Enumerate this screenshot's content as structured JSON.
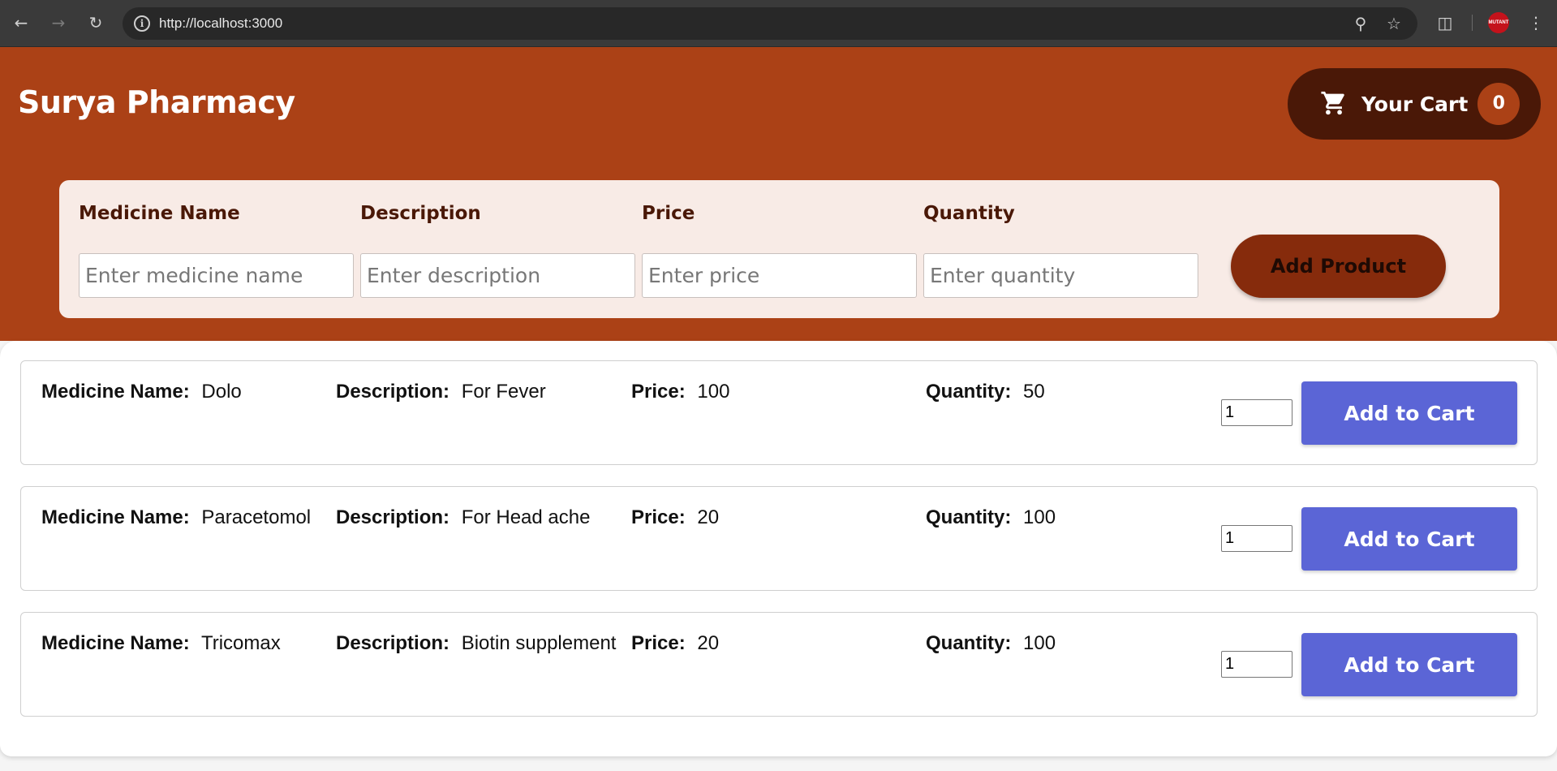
{
  "browser": {
    "url": "http://localhost:3000",
    "profile_badge": "MUTANT"
  },
  "header": {
    "brand": "Surya Pharmacy",
    "cart_label": "Your Cart",
    "cart_count": "0"
  },
  "form": {
    "fields": [
      {
        "label": "Medicine Name",
        "placeholder": "Enter medicine name"
      },
      {
        "label": "Description",
        "placeholder": "Enter description"
      },
      {
        "label": "Price",
        "placeholder": "Enter price"
      },
      {
        "label": "Quantity",
        "placeholder": "Enter quantity"
      }
    ],
    "submit_label": "Add Product"
  },
  "labels": {
    "name": "Medicine Name:",
    "description": "Description:",
    "price": "Price:",
    "quantity": "Quantity:",
    "add_to_cart": "Add to Cart"
  },
  "products": [
    {
      "name": "Dolo",
      "description": "For Fever",
      "price": "100",
      "quantity": "50",
      "order_qty": "1"
    },
    {
      "name": "Paracetomol",
      "description": "For Head ache",
      "price": "20",
      "quantity": "100",
      "order_qty": "1"
    },
    {
      "name": "Tricomax",
      "description": "Biotin supplement",
      "price": "20",
      "quantity": "100",
      "order_qty": "1"
    }
  ],
  "colors": {
    "header_bg": "#ab4116",
    "cart_bg": "#4a1807",
    "add_product_bg": "#862b0c",
    "add_to_cart_bg": "#5b65d6"
  }
}
